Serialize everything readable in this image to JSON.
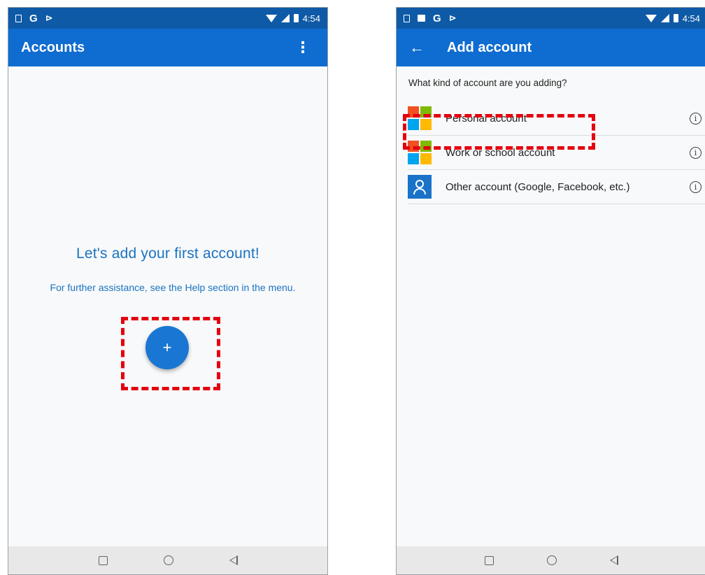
{
  "left_screen": {
    "status": {
      "time": "4:54",
      "icons": [
        "sim-icon",
        "g-icon",
        "flag-icon",
        "wifi-icon",
        "signal-icon",
        "battery-icon"
      ]
    },
    "app_bar": {
      "title": "Accounts",
      "menu_icon": "⋮"
    },
    "empty_state": {
      "title": "Let's add your first account!",
      "subtitle": "For further assistance, see the Help section in the menu."
    },
    "fab": {
      "label": "+"
    }
  },
  "right_screen": {
    "status": {
      "time": "4:54",
      "icons": [
        "sim-icon",
        "image-icon",
        "g-icon",
        "flag-icon",
        "wifi-icon",
        "signal-icon",
        "battery-icon"
      ]
    },
    "app_bar": {
      "title": "Add account",
      "back_icon": "←"
    },
    "question": "What kind of account are you adding?",
    "accounts": [
      {
        "label": "Personal account",
        "icon": "microsoft-logo-icon"
      },
      {
        "label": "Work or school account",
        "icon": "microsoft-logo-icon"
      },
      {
        "label": "Other account (Google, Facebook, etc.)",
        "icon": "person-icon"
      }
    ],
    "info_glyph": "i"
  },
  "colors": {
    "status_bar": "#0e5aa7",
    "app_bar": "#0f6cd0",
    "accent_text": "#1b73c2",
    "fab": "#1976d2",
    "highlight": "#e4000f"
  }
}
